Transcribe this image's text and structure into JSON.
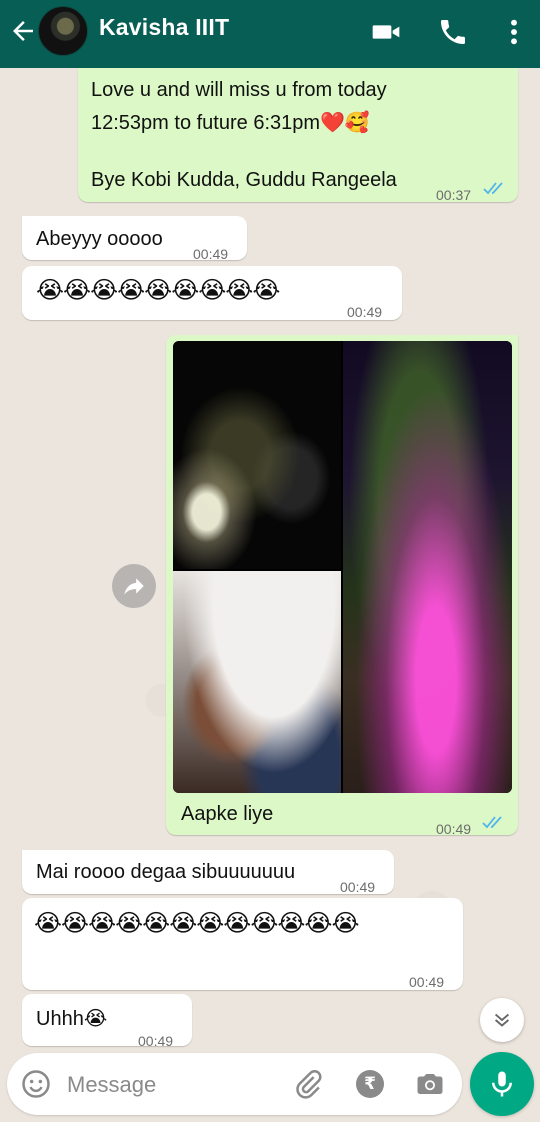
{
  "header": {
    "contact_name": "Kavisha IIIT",
    "background": "#075e54"
  },
  "messages": [
    {
      "direction": "outgoing",
      "lines": [
        "Love u and will miss u from today",
        "12:53pm to future 6:31pm❤️🥰",
        "Bye Kobi Kudda, Guddu Rangeela"
      ],
      "time": "00:37",
      "status": "read"
    },
    {
      "direction": "incoming",
      "text": "Abeyyy ooooo",
      "time": "00:49"
    },
    {
      "direction": "incoming",
      "text": "😭😭😭😭😭😭😭😭😭",
      "time": "00:49"
    },
    {
      "direction": "outgoing",
      "type": "photo",
      "caption": "Aapke liye",
      "time": "00:49",
      "status": "read"
    },
    {
      "direction": "incoming",
      "text": "Mai roooo degaa sibuuuuuuu",
      "time": "00:49"
    },
    {
      "direction": "incoming",
      "text": "😭😭😭😭😭😭😭😭😭😭😭😭",
      "time": "00:49"
    },
    {
      "direction": "incoming",
      "text": "Uhhh😭",
      "time": "00:49"
    }
  ],
  "input": {
    "placeholder": "Message",
    "value": ""
  },
  "icons": {
    "back": "arrow-left-icon",
    "video": "video-call-icon",
    "call": "phone-icon",
    "more": "more-vert-icon",
    "forward": "forward-icon",
    "scroll": "chevron-double-down-icon",
    "emoji": "emoji-icon",
    "attach": "paperclip-icon",
    "rupee": "rupee-icon",
    "camera": "camera-icon",
    "mic": "mic-icon"
  },
  "rupee_symbol": "₹",
  "colors": {
    "outgoing_bubble": "#dcf8c6",
    "incoming_bubble": "#ffffff",
    "accent": "#00a884",
    "read_ticks": "#4fb6ec"
  }
}
